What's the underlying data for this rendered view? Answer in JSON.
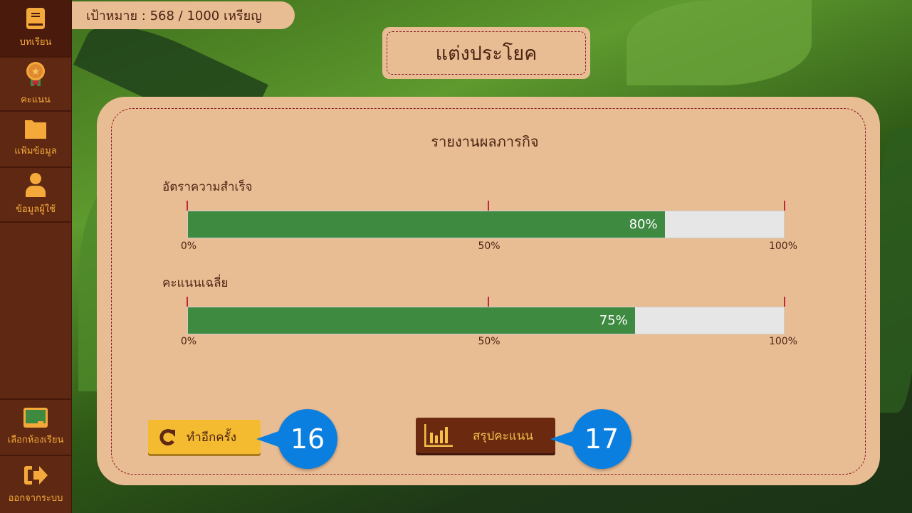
{
  "goal": "เป้าหมาย : 568 / 1000 เหรียญ",
  "title": "แต่งประโยค",
  "sidebar": {
    "items": [
      {
        "label": "บทเรียน",
        "icon": "book-icon",
        "active": true
      },
      {
        "label": "คะแนน",
        "icon": "medal-icon"
      },
      {
        "label": "แฟ้มข้อมูล",
        "icon": "folder-icon"
      },
      {
        "label": "ข้อมูลผู้ใช้",
        "icon": "user-icon"
      },
      {
        "label": "เลือกห้องเรียน",
        "icon": "classroom-board-icon"
      },
      {
        "label": "ออกจากระบบ",
        "icon": "logout-icon"
      }
    ]
  },
  "report": {
    "heading": "รายงานผลภารกิจ",
    "metrics": [
      {
        "label": "อัตราความสำเร็จ",
        "value": 80,
        "value_label": "80%"
      },
      {
        "label": "คะแนนเฉลี่ย",
        "value": 75,
        "value_label": "75%"
      }
    ],
    "scale": [
      "0%",
      "50%",
      "100%"
    ]
  },
  "buttons": {
    "retry": "ทำอีกครั้ง",
    "summary": "สรุปคะแนน"
  },
  "callouts": [
    "16",
    "17"
  ],
  "colors": {
    "sidebar": "#5e2812",
    "panel": "#e9bd94",
    "bar_fill": "#3d8a40",
    "retry": "#f5bb30",
    "summary": "#6b2a10",
    "callout": "#0a7fe0"
  }
}
